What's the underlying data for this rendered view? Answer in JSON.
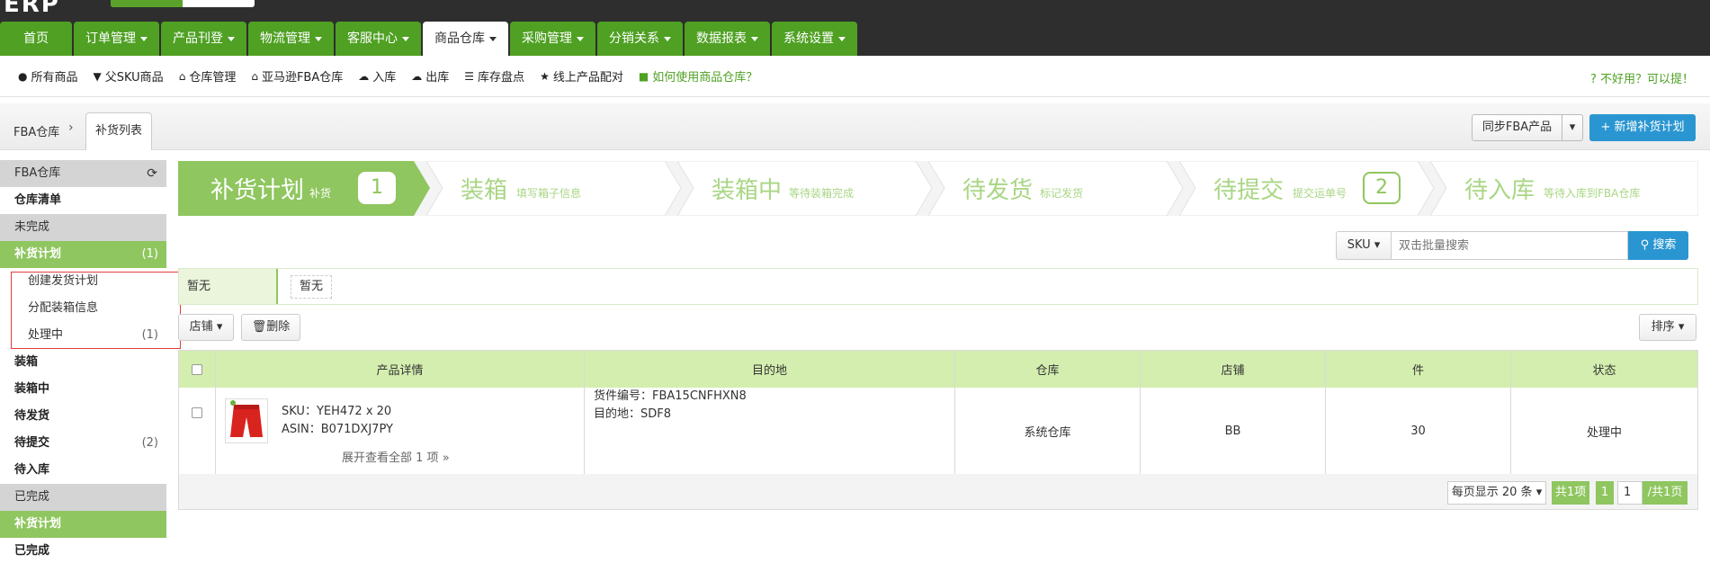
{
  "header": {
    "logo_text": "ERP",
    "nav": [
      {
        "label": "首页",
        "dropdown": false
      },
      {
        "label": "订单管理",
        "dropdown": true
      },
      {
        "label": "产品刊登",
        "dropdown": true
      },
      {
        "label": "物流管理",
        "dropdown": true
      },
      {
        "label": "客服中心",
        "dropdown": true
      },
      {
        "label": "商品仓库",
        "dropdown": true,
        "active": true
      },
      {
        "label": "采购管理",
        "dropdown": true
      },
      {
        "label": "分销关系",
        "dropdown": true
      },
      {
        "label": "数据报表",
        "dropdown": true
      },
      {
        "label": "系统设置",
        "dropdown": true
      }
    ]
  },
  "subbar": {
    "items": [
      {
        "icon": "circle-icon",
        "label": "所有商品"
      },
      {
        "icon": "filter-icon",
        "label": "父SKU商品"
      },
      {
        "icon": "home-icon",
        "label": "仓库管理"
      },
      {
        "icon": "home-icon",
        "label": "亚马逊FBA仓库"
      },
      {
        "icon": "cloud-upload-icon",
        "label": "入库"
      },
      {
        "icon": "cloud-download-icon",
        "label": "出库"
      },
      {
        "icon": "list-icon",
        "label": "库存盘点"
      },
      {
        "icon": "star-icon",
        "label": "线上产品配对"
      },
      {
        "icon": "video-icon",
        "label": "如何使用商品仓库？"
      }
    ],
    "feedback": "不好用？可以提！"
  },
  "breadcrumb": {
    "root": "FBA仓库",
    "tab": "补货列表",
    "sync_label": "同步FBA产品",
    "new_label": "新增补货计划"
  },
  "sidebar": {
    "title": "FBA仓库",
    "inventory": "仓库清单",
    "section_incomplete": "未完成",
    "plan": {
      "label": "补货计划",
      "count": "(1)"
    },
    "plan_children": [
      {
        "label": "创建发货计划",
        "count": ""
      },
      {
        "label": "分配装箱信息",
        "count": ""
      },
      {
        "label": "处理中",
        "count": "(1)"
      }
    ],
    "stages": [
      {
        "label": "装箱",
        "count": ""
      },
      {
        "label": "装箱中",
        "count": ""
      },
      {
        "label": "待发货",
        "count": ""
      },
      {
        "label": "待提交",
        "count": "(2)"
      },
      {
        "label": "待入库",
        "count": ""
      }
    ],
    "section_done": "已完成",
    "done_plan": "补货计划",
    "done": "已完成"
  },
  "steps": [
    {
      "title": "补货计划",
      "sub": "补货",
      "num": "1",
      "active": true
    },
    {
      "title": "装箱",
      "sub": "填写箱子信息",
      "num": ""
    },
    {
      "title": "装箱中",
      "sub": "等待装箱完成",
      "num": ""
    },
    {
      "title": "待发货",
      "sub": "标记发货",
      "num": ""
    },
    {
      "title": "待提交",
      "sub": "提交运单号",
      "num": "2"
    },
    {
      "title": "待入库",
      "sub": "等待入库到FBA仓库",
      "num": ""
    }
  ],
  "search": {
    "field": "SKU",
    "placeholder": "双击批量搜索",
    "button": "搜索"
  },
  "filter": {
    "label": "暂无",
    "chip": "暂无"
  },
  "actions": {
    "store": "店铺",
    "delete": "删除",
    "sort": "排序"
  },
  "table": {
    "headers": [
      "产品详情",
      "目的地",
      "仓库",
      "店铺",
      "件",
      "状态"
    ],
    "rows": [
      {
        "sku": "SKU：YEH472 x 20",
        "asin": "ASIN：B071DXJ7PY",
        "expand": "展开查看全部 1 项",
        "shipment": "货件编号：FBA15CNFHXN8",
        "dest": "目的地：SDF8",
        "warehouse": "系统仓库",
        "store": "BB",
        "qty": "30",
        "status": "处理中"
      }
    ]
  },
  "pagination": {
    "per_page": "每页显示 20 条",
    "total": "共1项",
    "current": "1",
    "input": "1",
    "pages": "/共1页"
  },
  "colors": {
    "nav_green": "#4fa023",
    "active_green": "#8fc65f",
    "step_light": "#a9d684",
    "blue": "#2a96d1",
    "header_bg": "#2e2e2e"
  }
}
